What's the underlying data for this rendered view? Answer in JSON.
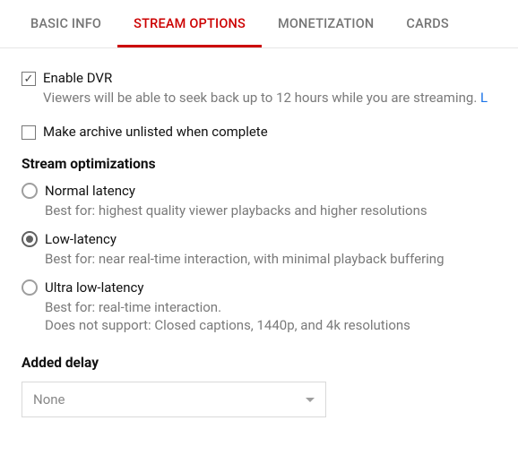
{
  "tabs": {
    "basic_info": "BASIC INFO",
    "stream_options": "STREAM OPTIONS",
    "monetization": "MONETIZATION",
    "cards": "CARDS"
  },
  "dvr": {
    "label": "Enable DVR",
    "desc": "Viewers will be able to seek back up to 12 hours while you are streaming. ",
    "link": "L"
  },
  "archive": {
    "label": "Make archive unlisted when complete"
  },
  "stream_opt_title": "Stream optimizations",
  "latency": {
    "normal": {
      "label": "Normal latency",
      "desc": "Best for: highest quality viewer playbacks and higher resolutions"
    },
    "low": {
      "label": "Low-latency",
      "desc": "Best for: near real-time interaction, with minimal playback buffering"
    },
    "ultra": {
      "label": "Ultra low-latency",
      "desc1": "Best for: real-time interaction.",
      "desc2": "Does not support: Closed captions, 1440p, and 4k resolutions"
    }
  },
  "added_delay": {
    "title": "Added delay",
    "value": "None"
  }
}
